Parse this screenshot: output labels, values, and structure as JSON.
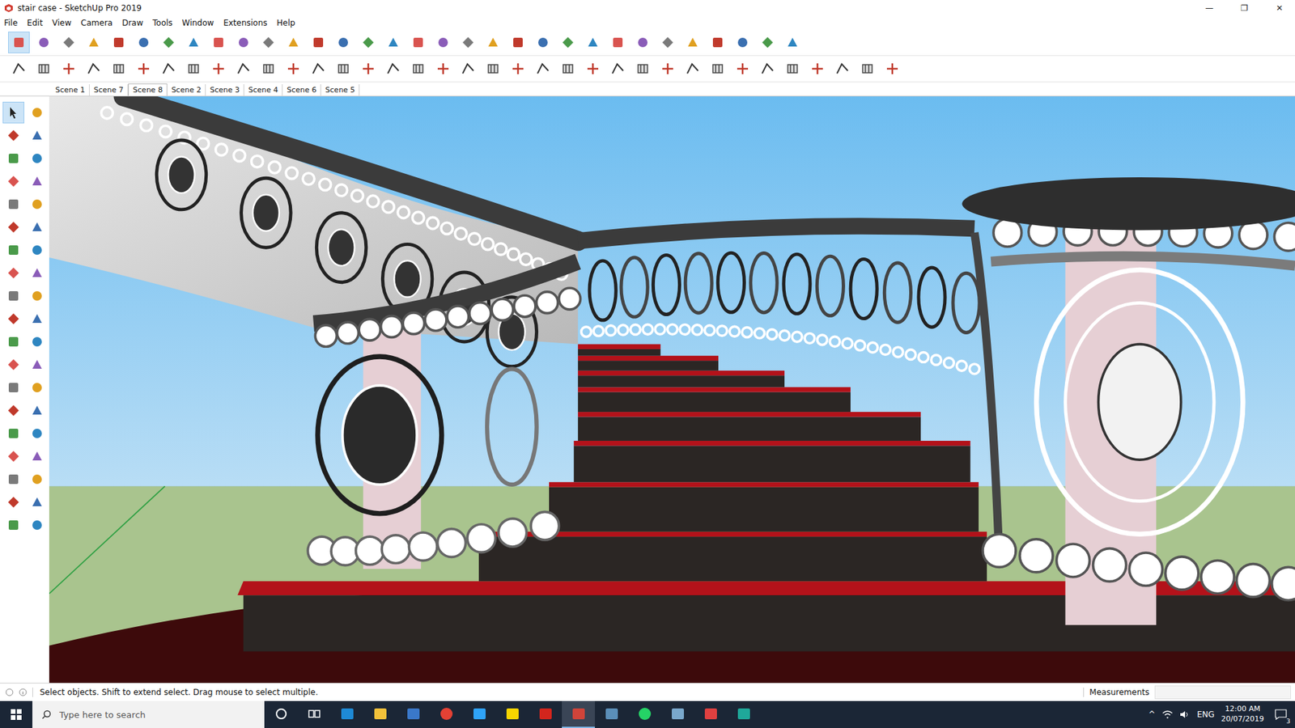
{
  "window": {
    "title": "stair case - SketchUp Pro 2019",
    "controls": [
      "—",
      "❐",
      "✕"
    ]
  },
  "menu": [
    "File",
    "Edit",
    "View",
    "Camera",
    "Draw",
    "Tools",
    "Window",
    "Extensions",
    "Help"
  ],
  "main_toolbar": [
    {
      "selected": true
    },
    {
      "selected": false
    },
    {
      "selected": false
    },
    {
      "selected": false
    },
    {
      "selected": false
    },
    {
      "selected": false
    },
    {
      "selected": false
    },
    {
      "selected": false
    },
    {
      "selected": false
    },
    {
      "selected": false
    },
    {
      "selected": false
    },
    {
      "selected": false
    },
    {
      "selected": false
    },
    {
      "selected": false
    },
    {
      "selected": false
    },
    {
      "selected": false
    },
    {
      "selected": false
    },
    {
      "selected": false
    },
    {
      "selected": false
    },
    {
      "selected": false
    },
    {
      "selected": false
    },
    {
      "selected": false
    },
    {
      "selected": false
    },
    {
      "selected": false
    },
    {
      "selected": false
    },
    {
      "selected": false
    },
    {
      "selected": false
    },
    {
      "selected": false
    },
    {
      "selected": false
    },
    {
      "selected": false
    },
    {
      "selected": false
    },
    {
      "selected": false
    }
  ],
  "secondary_toolbar": [
    {
      "selected": false
    },
    {
      "selected": false
    },
    {
      "selected": false
    },
    {
      "selected": false
    },
    {
      "selected": false
    },
    {
      "selected": false
    },
    {
      "selected": false
    },
    {
      "selected": false
    },
    {
      "selected": false
    },
    {
      "selected": false
    },
    {
      "selected": false
    },
    {
      "selected": false
    },
    {
      "selected": false
    },
    {
      "selected": false
    },
    {
      "selected": false
    },
    {
      "selected": false
    },
    {
      "selected": false
    },
    {
      "selected": false
    },
    {
      "selected": false
    },
    {
      "selected": false
    },
    {
      "selected": false
    },
    {
      "selected": false
    },
    {
      "selected": false
    },
    {
      "selected": false
    },
    {
      "selected": false
    },
    {
      "selected": false
    },
    {
      "selected": false
    },
    {
      "selected": false
    },
    {
      "selected": false
    },
    {
      "selected": false
    },
    {
      "selected": false
    },
    {
      "selected": false
    },
    {
      "selected": false
    },
    {
      "selected": false
    },
    {
      "selected": false
    },
    {
      "selected": false
    }
  ],
  "scenes": [
    {
      "label": "Scene 1",
      "selected": false
    },
    {
      "label": "Scene 7",
      "selected": false
    },
    {
      "label": "Scene 8",
      "selected": true
    },
    {
      "label": "Scene 2",
      "selected": false
    },
    {
      "label": "Scene 3",
      "selected": false
    },
    {
      "label": "Scene 4",
      "selected": false
    },
    {
      "label": "Scene 6",
      "selected": false
    },
    {
      "label": "Scene 5",
      "selected": false
    }
  ],
  "left_toolbar": [
    {
      "selected": true
    },
    {
      "selected": false
    },
    {
      "selected": false
    },
    {
      "selected": false
    },
    {
      "selected": false
    },
    {
      "selected": false
    },
    {
      "selected": false
    },
    {
      "selected": false
    },
    {
      "selected": false
    },
    {
      "selected": false
    },
    {
      "selected": false
    },
    {
      "selected": false
    },
    {
      "selected": false
    },
    {
      "selected": false
    },
    {
      "selected": false
    },
    {
      "selected": false
    },
    {
      "selected": false
    },
    {
      "selected": false
    },
    {
      "selected": false
    },
    {
      "selected": false
    },
    {
      "selected": false
    },
    {
      "selected": false
    },
    {
      "selected": false
    },
    {
      "selected": false
    },
    {
      "selected": false
    },
    {
      "selected": false
    },
    {
      "selected": false
    },
    {
      "selected": false
    },
    {
      "selected": false
    },
    {
      "selected": false
    },
    {
      "selected": false
    },
    {
      "selected": false
    },
    {
      "selected": false
    },
    {
      "selected": false
    },
    {
      "selected": false
    },
    {
      "selected": false
    },
    {
      "selected": false
    },
    {
      "selected": false
    }
  ],
  "status_bar": {
    "message": "Select objects. Shift to extend select. Drag mouse to select multiple.",
    "measurements_label": "Measurements"
  },
  "taskbar": {
    "search_placeholder": "Type here to search",
    "apps": [
      {
        "color": "#ffffff",
        "selected": false
      },
      {
        "color": "#ffffff",
        "selected": false
      },
      {
        "color": "#1e8ad6",
        "selected": false
      },
      {
        "color": "#f3c13a",
        "selected": false
      },
      {
        "color": "#3a78c9",
        "selected": false
      },
      {
        "color": "#e44134",
        "selected": false
      },
      {
        "color": "#2fa3f7",
        "selected": false
      },
      {
        "color": "#f7d500",
        "selected": false
      },
      {
        "color": "#d3251d",
        "selected": false
      },
      {
        "color": "#d0443a",
        "selected": true
      },
      {
        "color": "#5b8fb9",
        "selected": false
      },
      {
        "color": "#25d366",
        "selected": false
      },
      {
        "color": "#7aa8cc",
        "selected": false
      },
      {
        "color": "#e04040",
        "selected": false
      },
      {
        "color": "#1fa89a",
        "selected": false
      }
    ],
    "tray_arrow": "^",
    "language": "ENG",
    "time": "12:00 AM",
    "date": "20/07/2019",
    "notifications": "3"
  }
}
